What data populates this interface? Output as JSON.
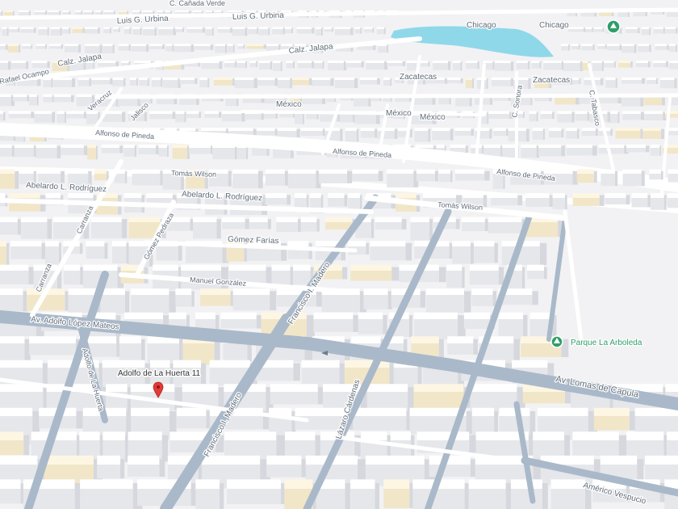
{
  "map": {
    "streets": {
      "canada_verde": "C. Cañada Verde",
      "luis_urbina_1": "Luis G. Urbina",
      "luis_urbina_2": "Luis G. Urbina",
      "chicago_1": "Chicago",
      "chicago_2": "Chicago",
      "calz_jalapa_1": "Calz. Jalapa",
      "calz_jalapa_2": "Calz. Jalapa",
      "rafael_ocampo": "Rafael Ocampo",
      "veracruz": "Veracruz",
      "jalisco": "Jalisco",
      "mexico_1": "México",
      "mexico_2": "México",
      "mexico_3": "México",
      "zacatecas_1": "Zacatecas",
      "zacatecas_2": "Zacatecas",
      "c_sonora": "C. Sonora",
      "c_tabasco": "C. Tabasco",
      "alfonso_pineda_1": "Alfonso de Pineda",
      "alfonso_pineda_2": "Alfonso de Pineda",
      "alfonso_pineda_3": "Alfonso de Pineda",
      "tomas_wilson_1": "Tomás Wilson",
      "tomas_wilson_2": "Tomás Wilson",
      "abelardo_1": "Abelardo L. Rodríguez",
      "abelardo_2": "Abelardo L. Rodríguez",
      "carranza_1": "Carranza",
      "carranza_2": "Carranza",
      "gomez_pedraza": "Gómez Pedraza",
      "gomez_farias": "Gómez Farías",
      "manuel_gonzalez": "Manuel González",
      "francisco_madero_1": "Francisco I. Madero",
      "francisco_madero_2": "Francisco I. Madero",
      "adolfo_lopez_mateos": "Av. Adolfo López Mateos",
      "adolfo_huerta": "Adolfo de La Huerta",
      "lomas_capula": "Av. Lomas de Capula",
      "lazaro_cardenas": "Lázaro Cárdenas",
      "americo_vespucio": "Américo Vespucio"
    },
    "places": {
      "pin_label": "Adolfo de La Huerta 11",
      "park_label": "Parque La Arboleda"
    },
    "colors": {
      "water": "#8fd8ea",
      "park_icon": "#2f9e6a",
      "pin": "#e53935",
      "major_road": "#aab9c9"
    },
    "icons": {
      "pin": "map-pin-icon",
      "park": "park-tree-icon"
    }
  }
}
